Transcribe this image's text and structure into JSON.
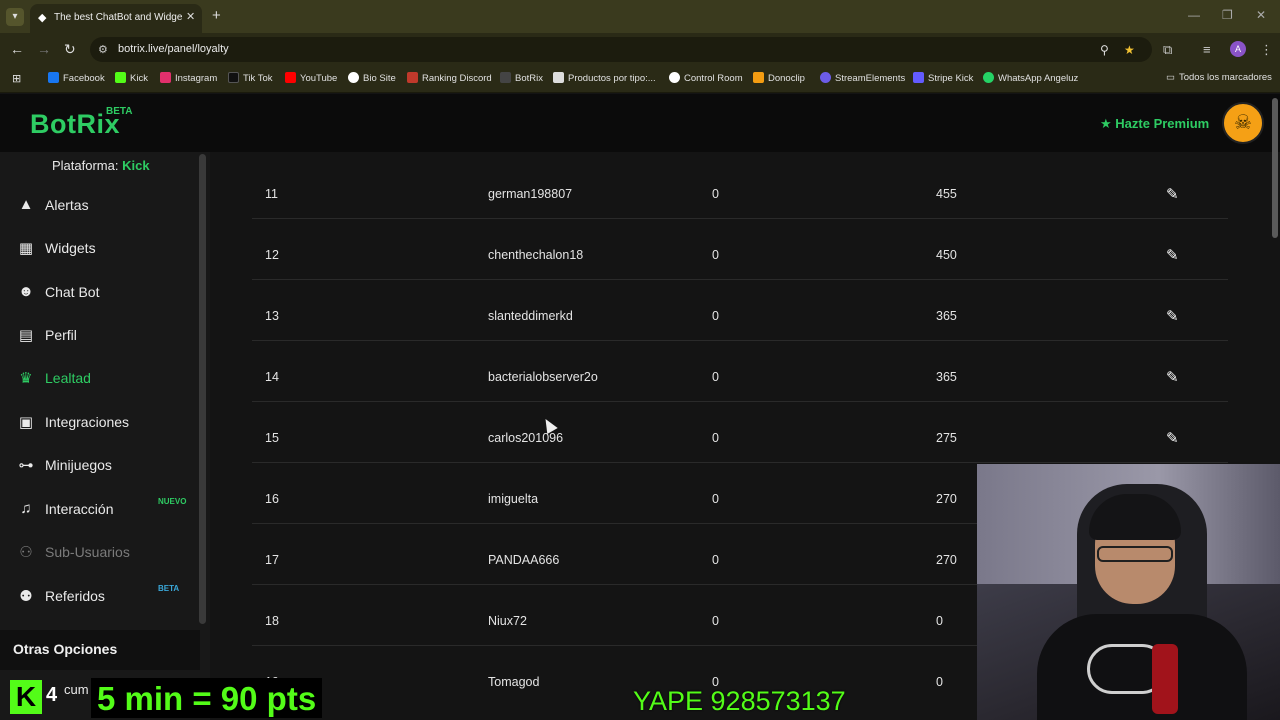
{
  "browser": {
    "tab_title": "The best ChatBot and Widgets",
    "url": "botrix.live/panel/loyalty",
    "profile_initial": "A",
    "bookmarks": [
      {
        "label": "Facebook",
        "color": "#1877f2"
      },
      {
        "label": "Kick",
        "color": "#53fc18"
      },
      {
        "label": "Instagram",
        "color": "#e1306c"
      },
      {
        "label": "Tik Tok",
        "color": "#111111"
      },
      {
        "label": "YouTube",
        "color": "#ff0000"
      },
      {
        "label": "Bio Site",
        "color": "#ffffff"
      },
      {
        "label": "Ranking Discord",
        "color": "#c0392b"
      },
      {
        "label": "BotRix",
        "color": "#444444"
      },
      {
        "label": "Productos por tipo:...",
        "color": "#dddddd"
      },
      {
        "label": "Control Room",
        "color": "#ffffff"
      },
      {
        "label": "Donoclip",
        "color": "#f39c12"
      },
      {
        "label": "StreamElements",
        "color": "#6c5ce7"
      },
      {
        "label": "Stripe Kick",
        "color": "#635bff"
      },
      {
        "label": "WhatsApp Angeluz",
        "color": "#25d366"
      }
    ],
    "all_bookmarks": "Todos los marcadores"
  },
  "header": {
    "logo": "BotRix",
    "logo_badge": "BETA",
    "premium_label": "Hazte Premium"
  },
  "sidebar": {
    "platform_label": "Plataforma:",
    "platform_value": "Kick",
    "items": [
      {
        "label": "Alertas",
        "icon": "warning-icon"
      },
      {
        "label": "Widgets",
        "icon": "grid-icon"
      },
      {
        "label": "Chat Bot",
        "icon": "robot-icon"
      },
      {
        "label": "Perfil",
        "icon": "profile-card-icon"
      },
      {
        "label": "Lealtad",
        "icon": "trophy-icon",
        "active": true
      },
      {
        "label": "Integraciones",
        "icon": "integration-icon"
      },
      {
        "label": "Minijuegos",
        "icon": "gamepad-icon"
      },
      {
        "label": "Interacción",
        "icon": "music-icon",
        "badge": "NUEVO"
      },
      {
        "label": "Sub-Usuarios",
        "icon": "users-icon",
        "disabled": true
      },
      {
        "label": "Referidos",
        "icon": "referrals-icon",
        "badge": "BETA"
      }
    ],
    "other_options": "Otras Opciones",
    "other_partial": "cum"
  },
  "table": {
    "rows": [
      {
        "rank": "11",
        "user": "german198807",
        "a": "0",
        "points": "455",
        "editable": true
      },
      {
        "rank": "12",
        "user": "chenthechalon18",
        "a": "0",
        "points": "450",
        "editable": true
      },
      {
        "rank": "13",
        "user": "slanteddimerkd",
        "a": "0",
        "points": "365",
        "editable": true
      },
      {
        "rank": "14",
        "user": "bacterialobserver2o",
        "a": "0",
        "points": "365",
        "editable": true
      },
      {
        "rank": "15",
        "user": "carlos201096",
        "a": "0",
        "points": "275",
        "editable": true
      },
      {
        "rank": "16",
        "user": "imiguelta",
        "a": "0",
        "points": "270",
        "editable": false
      },
      {
        "rank": "17",
        "user": "PANDAA666",
        "a": "0",
        "points": "270",
        "editable": false
      },
      {
        "rank": "18",
        "user": "Niux72",
        "a": "0",
        "points": "0",
        "editable": false
      },
      {
        "rank": "19",
        "user": "Tomagod",
        "a": "0",
        "points": "0",
        "editable": false
      }
    ]
  },
  "overlay": {
    "kick_letter": "K",
    "kick_count": "4",
    "promo": "5 min = 90 pts",
    "yape": "YAPE 928573137"
  },
  "colors": {
    "accent": "#2ecc63",
    "kick_green": "#53fc18",
    "badge_blue": "#3aa7d8"
  }
}
